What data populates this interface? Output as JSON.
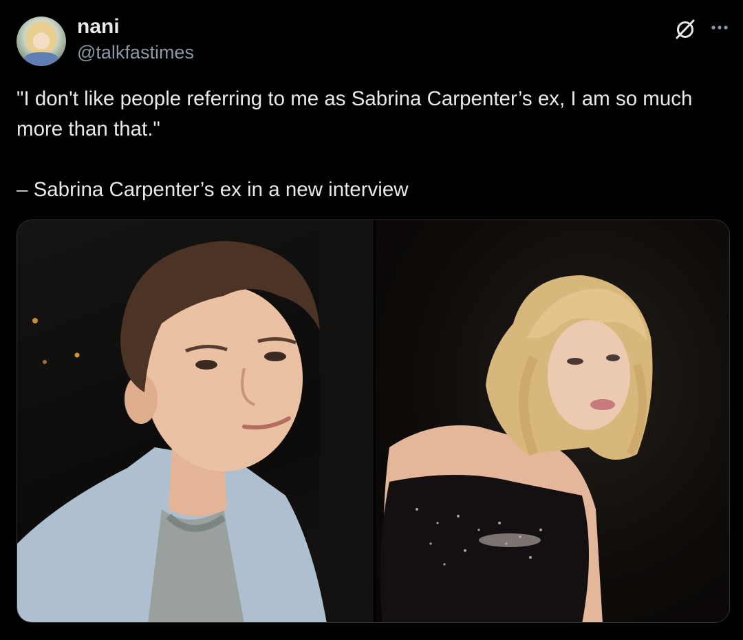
{
  "author": {
    "display_name": "nani",
    "handle": "@talkfastimes",
    "avatar_icon": "profile-avatar"
  },
  "actions": {
    "grok_icon": "grok-icon",
    "more_icon": "more-options-icon"
  },
  "tweet": {
    "line1": "\"I don't like people referring to me as Sabrina Carpenter’s ex, I am so much more than that.\"",
    "line2": "– Sabrina Carpenter’s ex in a new interview"
  },
  "media": {
    "count": 2,
    "images": [
      {
        "subject": "young man with brown hair in light blue jacket"
      },
      {
        "subject": "blonde woman in sparkly black top"
      }
    ]
  },
  "colors": {
    "background": "#000000",
    "text": "#e7e9ea",
    "secondary": "#8b98a5",
    "border": "#2f3336"
  }
}
